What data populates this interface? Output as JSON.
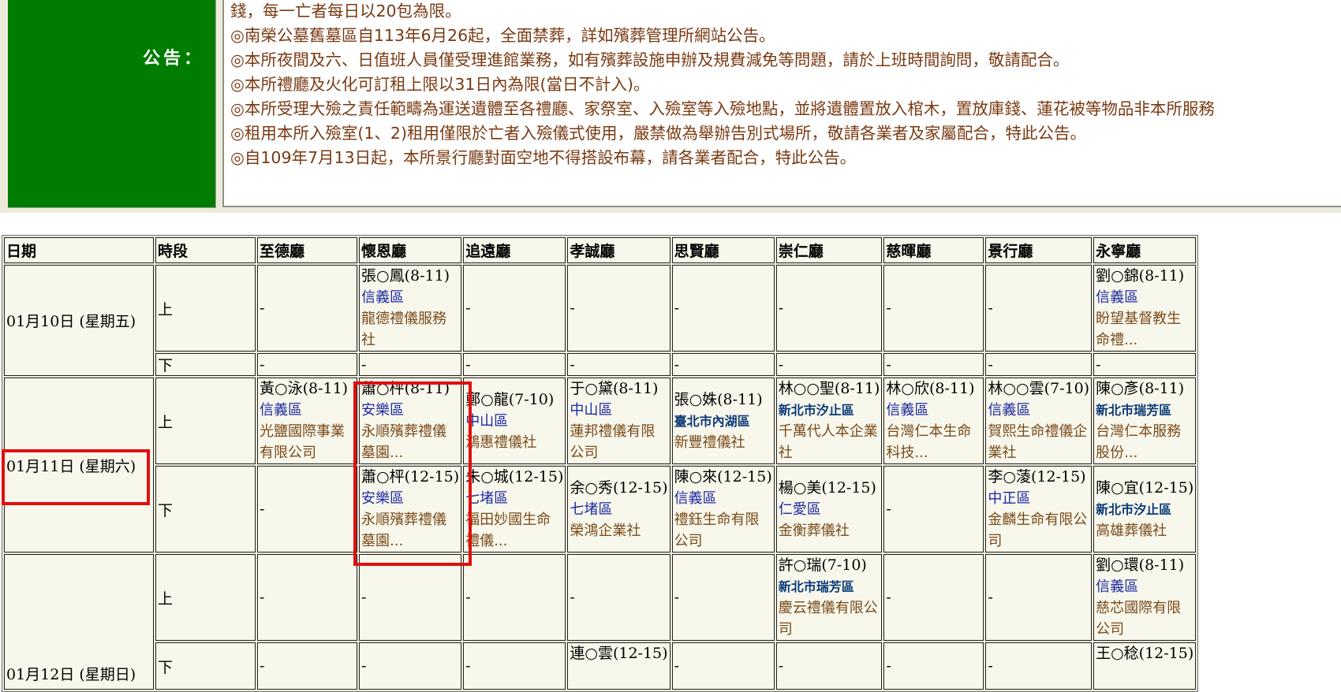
{
  "notice": {
    "label": "公告：",
    "lines": [
      "錢，每一亡者每日以20包為限。",
      "◎南榮公墓舊墓區自113年6月26起，全面禁葬，詳如殯葬管理所網站公告。",
      "◎本所夜間及六、日值班人員僅受理進館業務，如有殯葬設施申辦及規費減免等問題，請於上班時間詢問，敬請配合。",
      "◎本所禮廳及火化可訂租上限以31日內為限(當日不計入)。",
      "◎本所受理大殮之責任範疇為運送遺體至各禮廳、家祭室、入殮室等入殮地點，並將遺體置放入棺木，置放庫錢、蓮花被等物品非本所服務",
      "◎租用本所入殮室(1、2)租用僅限於亡者入殮儀式使用，嚴禁做為舉辦告別式場所，敬請各業者及家屬配合，特此公告。",
      "◎自109年7月13日起，本所景行廳對面空地不得搭設布幕，請各業者配合，特此公告。"
    ]
  },
  "table": {
    "headers": [
      "日期",
      "時段",
      "至德廳",
      "懷恩廳",
      "追遠廳",
      "孝誠廳",
      "思賢廳",
      "崇仁廳",
      "慈暉廳",
      "景行廳",
      "永寧廳"
    ],
    "empty": "-",
    "days": [
      {
        "date": "01月10日 (星期五)",
        "rows": [
          {
            "period": "上",
            "cells": [
              null,
              {
                "name": "張○鳳(8-11)",
                "district": "信義區",
                "agency": "龍德禮儀服務社"
              },
              null,
              null,
              null,
              null,
              null,
              null,
              {
                "name": "劉○錦(8-11)",
                "district": "信義區",
                "agency": "盼望基督教生命禮..."
              }
            ]
          },
          {
            "period": "下",
            "cells": [
              null,
              null,
              null,
              null,
              null,
              null,
              null,
              null,
              null
            ]
          }
        ]
      },
      {
        "date": "01月11日 (星期六)",
        "rows": [
          {
            "period": "上",
            "cells": [
              {
                "name": "黃○泳(8-11)",
                "district": "信義區",
                "agency": "光鹽國際事業有限公司"
              },
              {
                "name": "蕭○枰(8-11)",
                "district": "安樂區",
                "agency": "永順殯葬禮儀墓園..."
              },
              {
                "name": "鄭○龍(7-10)",
                "district": "中山區",
                "agency": "鴻惠禮儀社"
              },
              {
                "name": "于○黛(8-11)",
                "district": "中山區",
                "agency": "蓮邦禮儀有限公司"
              },
              {
                "name": "張○姝(8-11)",
                "district": "臺北市內湖區",
                "district_bold": true,
                "agency": "新豐禮儀社"
              },
              {
                "name": "林○○聖(8-11)",
                "district": "新北市汐止區",
                "district_bold": true,
                "agency": "千萬代人本企業社"
              },
              {
                "name": "林○欣(8-11)",
                "district": "信義區",
                "agency": "台灣仁本生命科技..."
              },
              {
                "name": "林○○雲(7-10)",
                "district": "信義區",
                "agency": "賀熙生命禮儀企業社"
              },
              {
                "name": "陳○彥(8-11)",
                "district": "新北市瑞芳區",
                "district_bold": true,
                "agency": "台灣仁本服務股份..."
              }
            ]
          },
          {
            "period": "下",
            "cells": [
              null,
              {
                "name": "蕭○枰(12-15)",
                "district": "安樂區",
                "agency": "永順殯葬禮儀墓園..."
              },
              {
                "name": "朱○城(12-15)",
                "district": "七堵區",
                "agency": "福田妙國生命禮儀..."
              },
              {
                "name": "余○秀(12-15)",
                "district": "七堵區",
                "agency": "榮鴻企業社"
              },
              {
                "name": "陳○來(12-15)",
                "district": "信義區",
                "agency": "禮鈺生命有限公司"
              },
              {
                "name": "楊○美(12-15)",
                "district": "仁愛區",
                "agency": "金衡葬儀社"
              },
              null,
              {
                "name": "李○蓤(12-15)",
                "district": "中正區",
                "agency": "金麟生命有限公司"
              },
              {
                "name": "陳○宜(12-15)",
                "district": "新北市汐止區",
                "district_bold": true,
                "agency": "高雄葬儀社"
              }
            ]
          }
        ]
      },
      {
        "date": "01月12日 (星期日)",
        "rows": [
          {
            "period": "上",
            "cells": [
              null,
              null,
              null,
              null,
              null,
              {
                "name": "許○瑞(7-10)",
                "district": "新北市瑞芳區",
                "district_bold": true,
                "agency": "慶云禮儀有限公司"
              },
              null,
              null,
              {
                "name": "劉○環(8-11)",
                "district": "信義區",
                "agency": "慈芯國際有限公司"
              }
            ]
          },
          {
            "period": "下",
            "cells": [
              null,
              null,
              null,
              {
                "name": "連○雲(12-15)"
              },
              null,
              null,
              null,
              null,
              {
                "name": "王○稔(12-15)"
              }
            ]
          }
        ]
      }
    ]
  },
  "highlight": {
    "color": "#e01010"
  }
}
